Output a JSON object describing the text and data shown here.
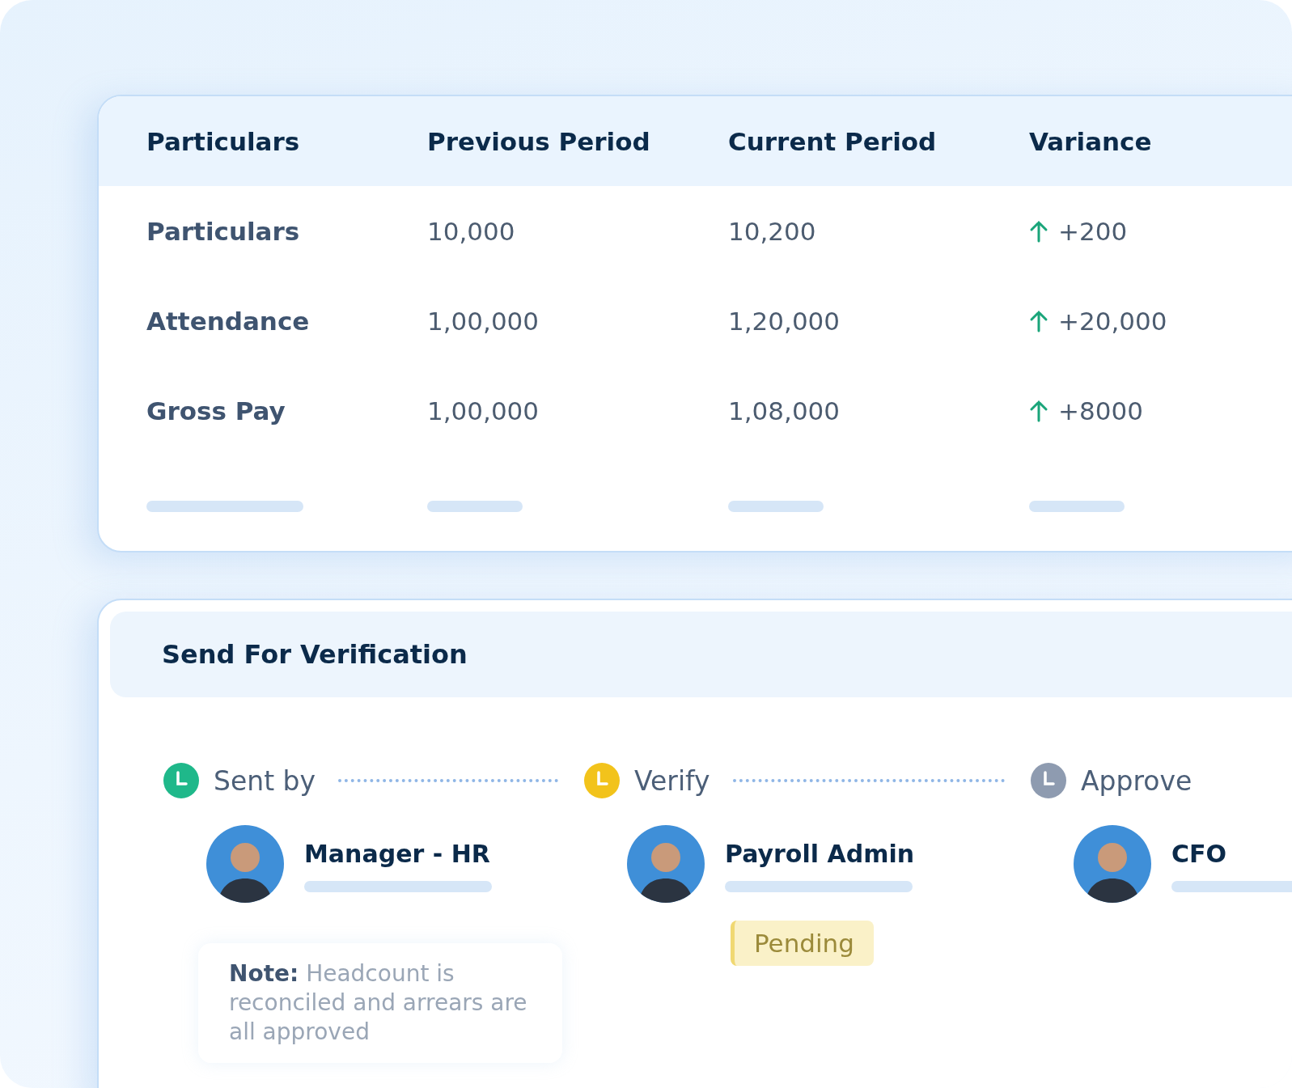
{
  "table": {
    "columns": [
      "Particulars",
      "Previous Period",
      "Current Period",
      "Variance"
    ],
    "rows": [
      {
        "label": "Particulars",
        "previous": "10,000",
        "current": "10,200",
        "variance": "+200",
        "rising": true
      },
      {
        "label": "Attendance",
        "previous": "1,00,000",
        "current": "1,20,000",
        "variance": "+20,000",
        "rising": true
      },
      {
        "label": "Gross Pay",
        "previous": "1,00,000",
        "current": "1,08,000",
        "variance": "+8000",
        "rising": true
      }
    ]
  },
  "verification": {
    "title": "Send For Verification",
    "steps": [
      {
        "label": "Sent by",
        "color": "#1fb88a",
        "person": "Manager - HR",
        "note": "**Note:** Headcount is reconciled and arrears are all approved"
      },
      {
        "label": "Verify",
        "color": "#f2c31b",
        "person": "Payroll Admin",
        "status": "Pending"
      },
      {
        "label": "Approve",
        "color": "#8e9bb0",
        "person": "CFO"
      }
    ]
  }
}
